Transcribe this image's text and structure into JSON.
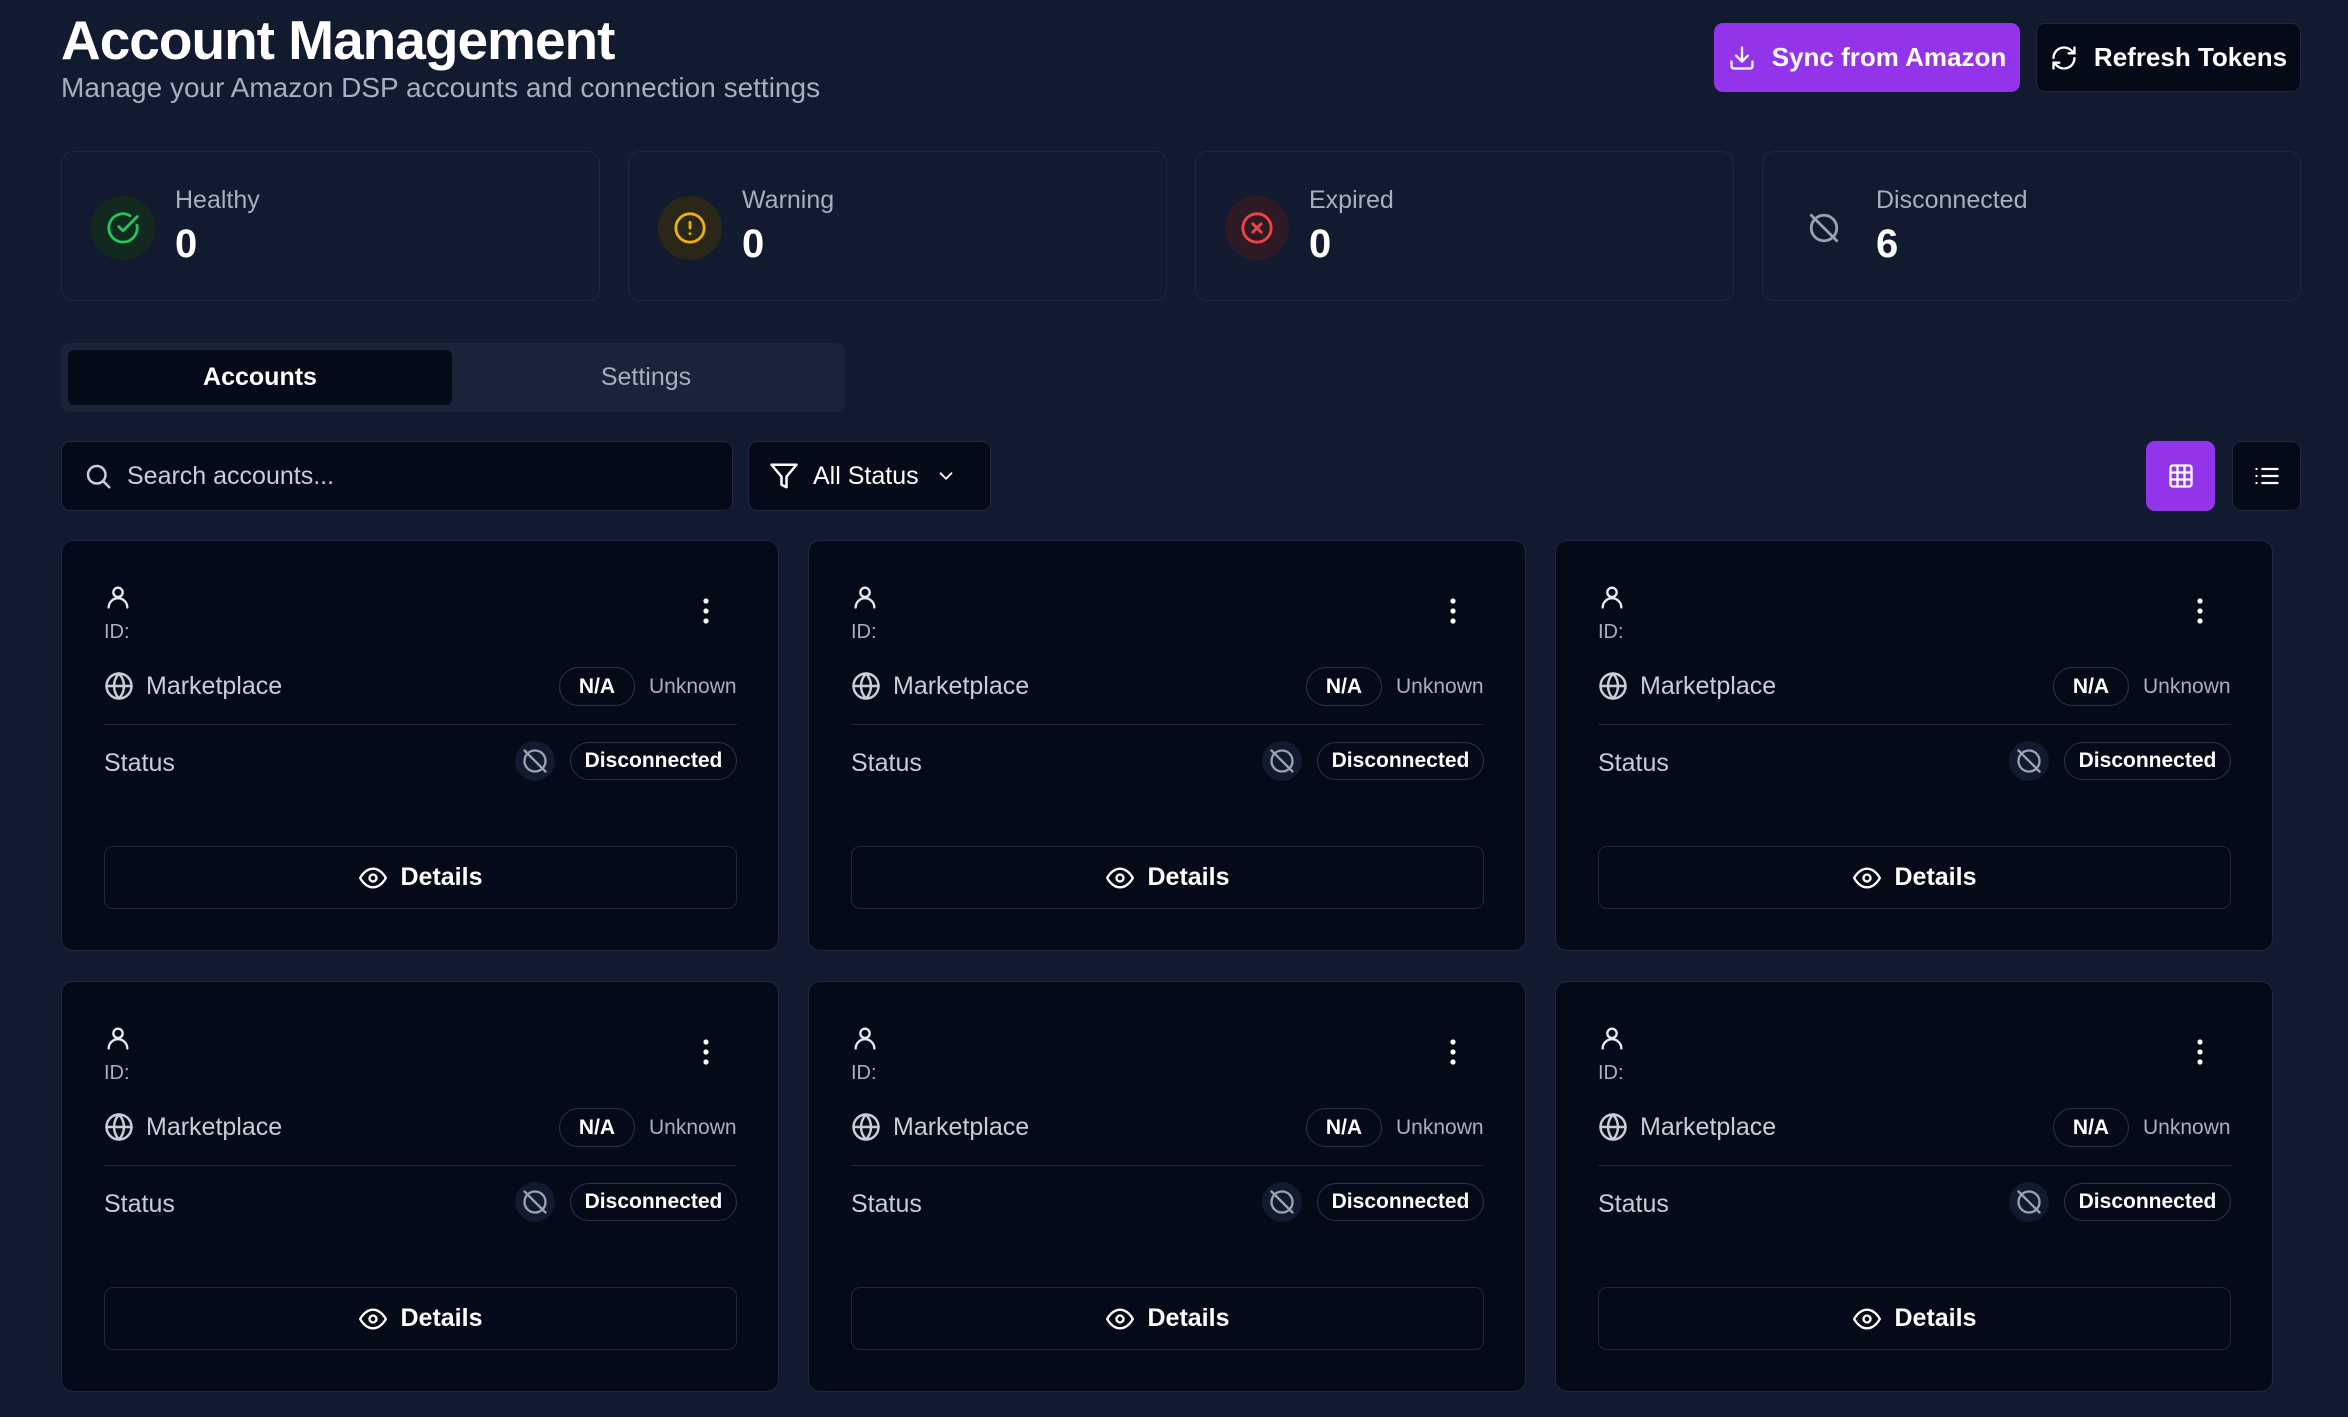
{
  "header": {
    "title": "Account Management",
    "subtitle": "Manage your Amazon DSP accounts and connection settings",
    "sync_label": "Sync from Amazon",
    "refresh_label": "Refresh Tokens"
  },
  "stats": [
    {
      "label": "Healthy",
      "value": "0",
      "icon": "check-circle-icon",
      "color": "#22c55e"
    },
    {
      "label": "Warning",
      "value": "0",
      "icon": "alert-circle-icon",
      "color": "#eab308"
    },
    {
      "label": "Expired",
      "value": "0",
      "icon": "x-circle-icon",
      "color": "#ef4444"
    },
    {
      "label": "Disconnected",
      "value": "6",
      "icon": "disconnected-icon",
      "color": "#9ca3af"
    }
  ],
  "tabs": {
    "accounts": "Accounts",
    "settings": "Settings"
  },
  "filters": {
    "search_placeholder": "Search accounts...",
    "status_selected": "All Status"
  },
  "accounts": [
    {
      "id_label": "ID:",
      "marketplace_label": "Marketplace",
      "marketplace_code": "N/A",
      "marketplace_region": "Unknown",
      "status_label": "Status",
      "status": "Disconnected",
      "details_label": "Details"
    },
    {
      "id_label": "ID:",
      "marketplace_label": "Marketplace",
      "marketplace_code": "N/A",
      "marketplace_region": "Unknown",
      "status_label": "Status",
      "status": "Disconnected",
      "details_label": "Details"
    },
    {
      "id_label": "ID:",
      "marketplace_label": "Marketplace",
      "marketplace_code": "N/A",
      "marketplace_region": "Unknown",
      "status_label": "Status",
      "status": "Disconnected",
      "details_label": "Details"
    },
    {
      "id_label": "ID:",
      "marketplace_label": "Marketplace",
      "marketplace_code": "N/A",
      "marketplace_region": "Unknown",
      "status_label": "Status",
      "status": "Disconnected",
      "details_label": "Details"
    },
    {
      "id_label": "ID:",
      "marketplace_label": "Marketplace",
      "marketplace_code": "N/A",
      "marketplace_region": "Unknown",
      "status_label": "Status",
      "status": "Disconnected",
      "details_label": "Details"
    },
    {
      "id_label": "ID:",
      "marketplace_label": "Marketplace",
      "marketplace_code": "N/A",
      "marketplace_region": "Unknown",
      "status_label": "Status",
      "status": "Disconnected",
      "details_label": "Details"
    }
  ],
  "colors": {
    "accent": "#9333ea",
    "background": "#111a2e",
    "card": "#050a18"
  }
}
